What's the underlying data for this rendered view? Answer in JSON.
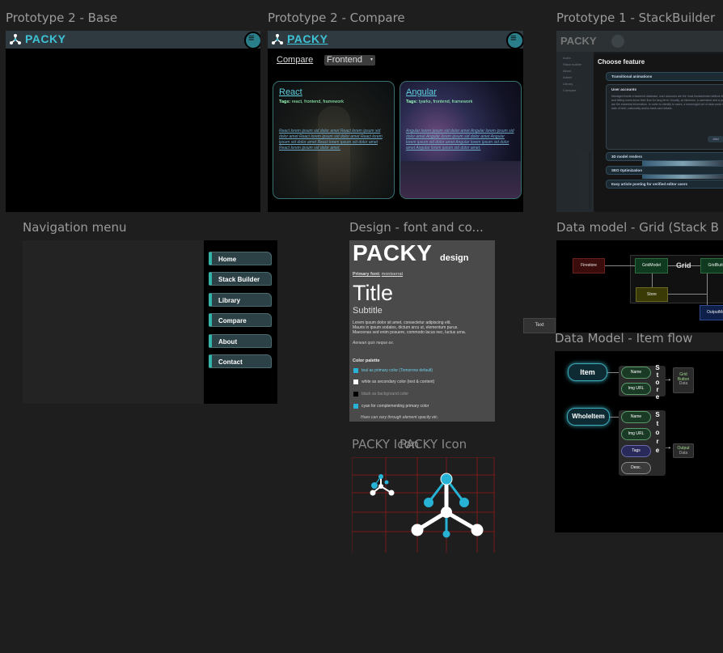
{
  "frames": {
    "proto2_base": {
      "title": "Prototype 2 - Base",
      "brand": "PACKY"
    },
    "proto2_compare": {
      "title": "Prototype 2 - Compare",
      "brand": "PACKY",
      "compare_label": "Compare",
      "select_value": "Frontend",
      "cards": [
        {
          "title": "React",
          "tags_label": "Tags:",
          "tags": "react, frontend, framework",
          "text": "React lorem ipsum sid dolor amet React lorem ipsum sid dolor amet React lorem ipsum sid dolor amet React lorem ipsum sid dolor amet React lorem ipsum sid dolor amet React lorem ipsum sid dolor amet."
        },
        {
          "title": "Angular",
          "tags_label": "Tags:",
          "tags": "tyarks, frontend, framework",
          "text": "Angular lorem ipsum sid dolor amet Angular lorem ipsum sid dolor amet Angular lorem ipsum sid dolor amet Angular lorem ipsum sid dolor amet Angular lorem ipsum sid dolor amet Angular lorem ipsum sid dolor amet."
        }
      ]
    },
    "proto1": {
      "title": "Prototype 1 - StackBuilder",
      "brand": "PACKY",
      "side_items": [
        "Index",
        "Stack builder",
        "About",
        "Admin",
        "Library",
        "Compare"
      ],
      "modal_title": "Choose feature",
      "features": [
        "Transitional animations",
        "User accounts",
        "3D model renders",
        "SEO Optimization",
        "Easy article posting for verified editor users"
      ],
      "user_accounts_text": "Managed inside a backend database, user accounts are the most fundamental method of storing and letting users know their flow for long-term. Usually, at minimum, a username and a password are the essential information. In order to identify to users, a meaningful set of data could include date of birth, nationality and/or bank card details.",
      "add_label": "Add"
    },
    "nav_menu": {
      "title": "Navigation menu",
      "items": [
        "Home",
        "Stack Builder",
        "Library",
        "Compare",
        "About",
        "Contact"
      ]
    },
    "design": {
      "title": "Design - font and co...",
      "brand": "PACKY",
      "brand_suffix": "design",
      "primary_font_label": "Primary font:",
      "primary_font": "montserrat",
      "title_sample": "Title",
      "subtitle_sample": "Subtitle",
      "lorem1": "Lorem ipsum dolor sit amet, consectetur adipiscing elit.",
      "lorem2": "Mauris in ipsum sodales, dictum arcu ut, elementum purus.",
      "lorem3": "Maecenas sed enim posuere, commodo lacus nec, luctus urna.",
      "lorem_italic": "Aenean quis neque ex.",
      "palette_label": "Color palette",
      "palette": [
        {
          "color": "#26b3d6",
          "text": "teal as primary color (Tomorrow default)"
        },
        {
          "color": "#ffffff",
          "text": "white as secondary color (text & content)"
        },
        {
          "color": "#000000",
          "text": "black as background color"
        },
        {
          "color": "#26b3d6",
          "text": "cyan for complementing primary color"
        }
      ],
      "palette_note": "Hues can vary through element opacity etc."
    },
    "text_chip": "Text",
    "icon": {
      "title_back": "PACKY Icon",
      "title_front": "PACKY Icon"
    },
    "grid_model": {
      "title": "Data model - Grid (Stack B",
      "firestore": "Firestore",
      "gridmodel": "GridModel",
      "grid": "Grid",
      "gridbutton": "GridButto",
      "store": "Store",
      "outputmodel": "OutputMo"
    },
    "item_flow": {
      "title": "Data Model - Item flow",
      "item": "Item",
      "whole_item": "WholeItem",
      "fields1": [
        "Name",
        "Img URL"
      ],
      "fields2": [
        "Name",
        "Img URL",
        "Tags",
        "Desc."
      ],
      "store_letters": [
        "S",
        "t",
        "o",
        "r",
        "e"
      ],
      "out1": [
        "Grid",
        "Button",
        "Data"
      ],
      "out2": [
        "Output",
        "Data"
      ]
    }
  }
}
